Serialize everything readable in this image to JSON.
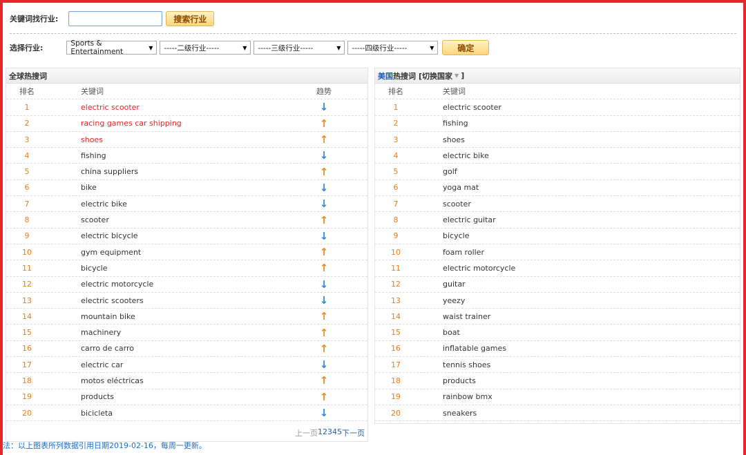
{
  "search": {
    "label": "关键词找行业:",
    "input_value": "",
    "button_label": "搜索行业"
  },
  "industry_select": {
    "label": "选择行业:",
    "level1": "Sports & Entertainment",
    "level2": "-----二级行业-----",
    "level3": "-----三级行业-----",
    "level4": "-----四级行业-----",
    "confirm_label": "确定"
  },
  "global_panel": {
    "title": "全球热搜词",
    "col_rank": "排名",
    "col_keyword": "关键词",
    "col_trend": "趋势",
    "rows": [
      {
        "rank": "1",
        "keyword": "electric scooter",
        "trend": "down",
        "hot": true
      },
      {
        "rank": "2",
        "keyword": "racing games car shipping",
        "trend": "up",
        "hot": true
      },
      {
        "rank": "3",
        "keyword": "shoes",
        "trend": "up",
        "hot": true
      },
      {
        "rank": "4",
        "keyword": "fishing",
        "trend": "down",
        "hot": false
      },
      {
        "rank": "5",
        "keyword": "china suppliers",
        "trend": "up",
        "hot": false
      },
      {
        "rank": "6",
        "keyword": "bike",
        "trend": "down",
        "hot": false
      },
      {
        "rank": "7",
        "keyword": "electric bike",
        "trend": "down",
        "hot": false
      },
      {
        "rank": "8",
        "keyword": "scooter",
        "trend": "up",
        "hot": false
      },
      {
        "rank": "9",
        "keyword": "electric bicycle",
        "trend": "down",
        "hot": false
      },
      {
        "rank": "10",
        "keyword": "gym equipment",
        "trend": "up",
        "hot": false
      },
      {
        "rank": "11",
        "keyword": "bicycle",
        "trend": "up",
        "hot": false
      },
      {
        "rank": "12",
        "keyword": "electric motorcycle",
        "trend": "down",
        "hot": false
      },
      {
        "rank": "13",
        "keyword": "electric scooters",
        "trend": "down",
        "hot": false
      },
      {
        "rank": "14",
        "keyword": "mountain bike",
        "trend": "up",
        "hot": false
      },
      {
        "rank": "15",
        "keyword": "machinery",
        "trend": "up",
        "hot": false
      },
      {
        "rank": "16",
        "keyword": "carro de carro",
        "trend": "up",
        "hot": false
      },
      {
        "rank": "17",
        "keyword": "electric car",
        "trend": "down",
        "hot": false
      },
      {
        "rank": "18",
        "keyword": "motos eléctricas",
        "trend": "up",
        "hot": false
      },
      {
        "rank": "19",
        "keyword": "products",
        "trend": "up",
        "hot": false
      },
      {
        "rank": "20",
        "keyword": "bicicleta",
        "trend": "down",
        "hot": false
      }
    ],
    "pager": {
      "prev": "上一页",
      "pages": [
        "1",
        "2",
        "3",
        "4",
        "5"
      ],
      "next": "下一页"
    }
  },
  "country_panel": {
    "country": "美国",
    "title_suffix": "热搜词",
    "switch_label": "[切换国家",
    "switch_close": "]",
    "col_rank": "排名",
    "col_keyword": "关键词",
    "rows": [
      {
        "rank": "1",
        "keyword": "electric scooter"
      },
      {
        "rank": "2",
        "keyword": "fishing"
      },
      {
        "rank": "3",
        "keyword": "shoes"
      },
      {
        "rank": "4",
        "keyword": "electric bike"
      },
      {
        "rank": "5",
        "keyword": "golf"
      },
      {
        "rank": "6",
        "keyword": "yoga mat"
      },
      {
        "rank": "7",
        "keyword": "scooter"
      },
      {
        "rank": "8",
        "keyword": "electric guitar"
      },
      {
        "rank": "9",
        "keyword": "bicycle"
      },
      {
        "rank": "10",
        "keyword": "foam roller"
      },
      {
        "rank": "11",
        "keyword": "electric motorcycle"
      },
      {
        "rank": "12",
        "keyword": "guitar"
      },
      {
        "rank": "13",
        "keyword": "yeezy"
      },
      {
        "rank": "14",
        "keyword": "waist trainer"
      },
      {
        "rank": "15",
        "keyword": "boat"
      },
      {
        "rank": "16",
        "keyword": "inflatable games"
      },
      {
        "rank": "17",
        "keyword": "tennis shoes"
      },
      {
        "rank": "18",
        "keyword": "products"
      },
      {
        "rank": "19",
        "keyword": "rainbow bmx"
      },
      {
        "rank": "20",
        "keyword": "sneakers"
      }
    ]
  },
  "footer_note": "法：以上图表所列数据引用日期2019-02-16，每周一更新。",
  "icons": {
    "trend_up": "arrow-up-icon",
    "trend_down": "arrow-down-icon",
    "select_arrow": "triangle-down-icon"
  },
  "colors": {
    "frame": "#e8262d",
    "rank": "#e77d1c",
    "hot_keyword": "#e22525",
    "trend_up": "#f08a1c",
    "trend_down": "#2c8de0",
    "link": "#1c6fc7"
  }
}
